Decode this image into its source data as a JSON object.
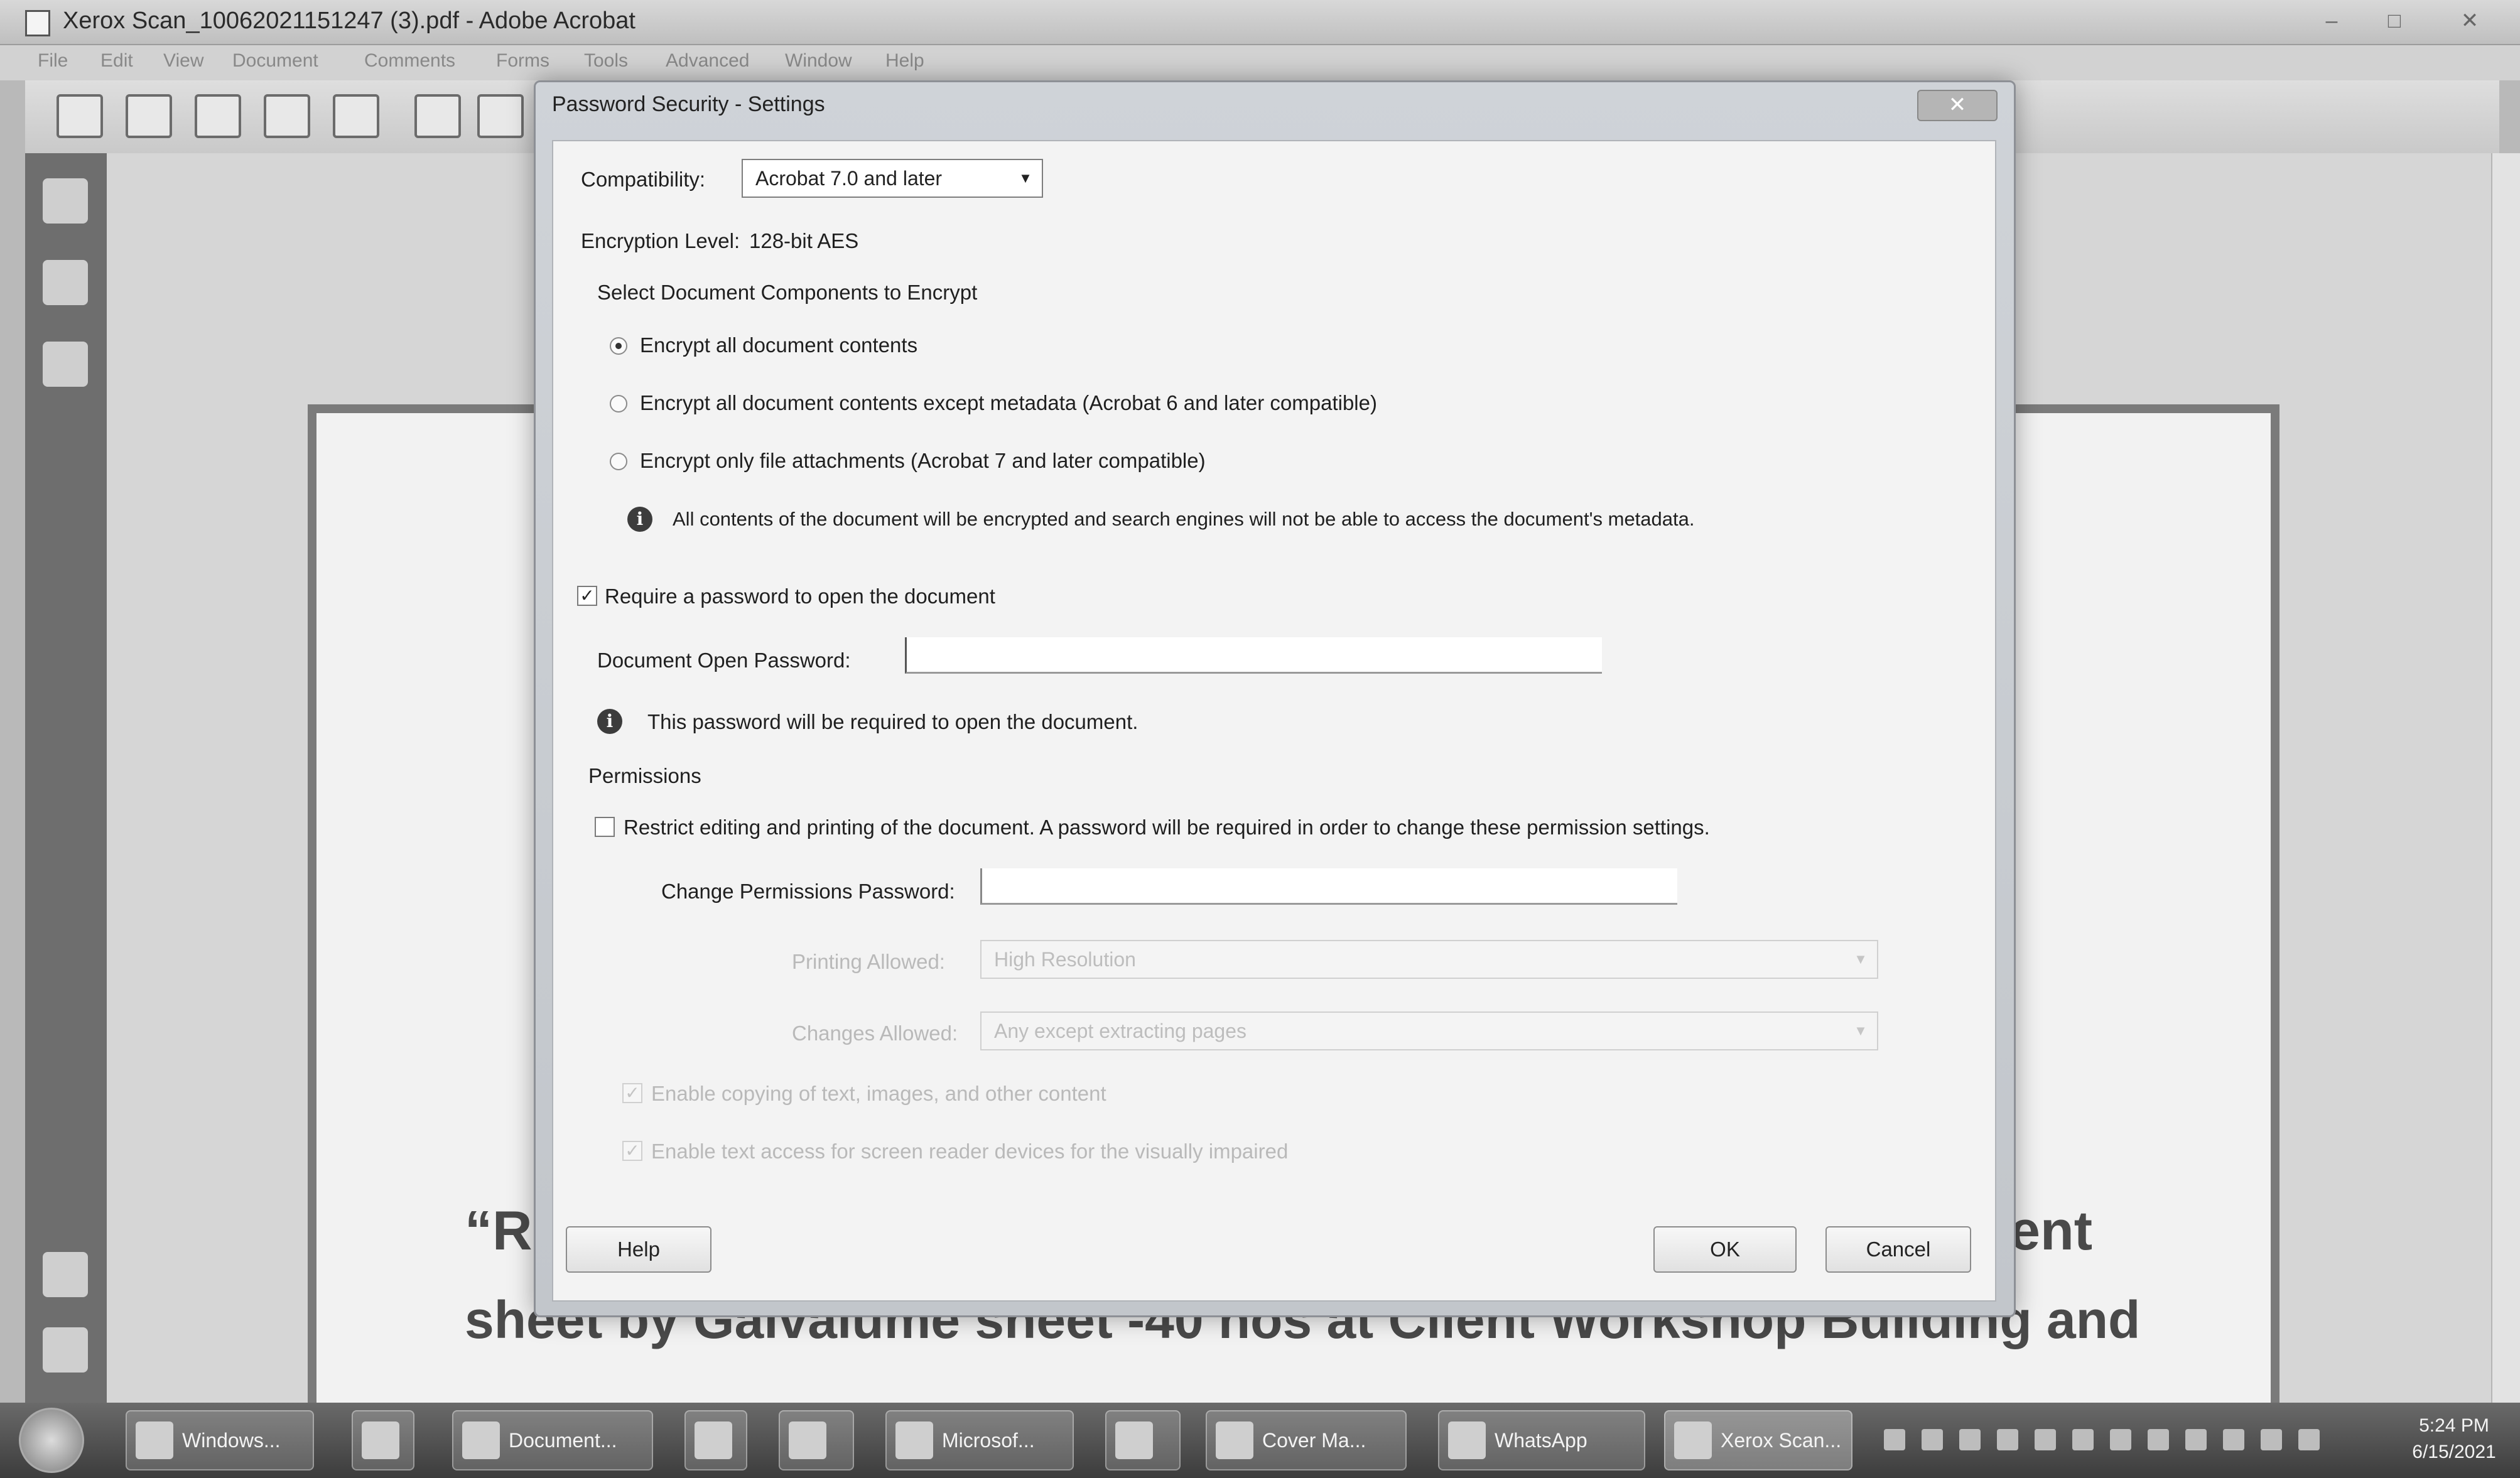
{
  "window": {
    "title": "Xerox Scan_10062021151247 (3).pdf - Adobe Acrobat",
    "controls": [
      "–",
      "□",
      "✕"
    ]
  },
  "menu": [
    "File",
    "Edit",
    "View",
    "Document",
    "Comments",
    "Forms",
    "Tools",
    "Advanced",
    "Window",
    "Help"
  ],
  "document": {
    "line1_start": "“R",
    "line1_end": "ent",
    "line2": "sheet by Galvalume sheet -40 nos at Client Workshop Building and"
  },
  "dialog": {
    "title": "Password Security - Settings",
    "compatibility_label": "Compatibility:",
    "compatibility_value": "Acrobat 7.0 and later",
    "encryption_level_label": "Encryption Level:",
    "encryption_level_value": "128-bit AES",
    "components_heading": "Select Document Components to Encrypt",
    "radio_all": "Encrypt all document contents",
    "radio_except_metadata": "Encrypt all document contents except metadata (Acrobat 6 and later compatible)",
    "radio_attachments": "Encrypt only file attachments (Acrobat 7 and later compatible)",
    "encrypt_info": "All contents of the document will be encrypted and search engines will not be able to access the document's metadata.",
    "require_open_password": "Require a password to open the document",
    "open_password_label": "Document Open Password:",
    "open_password_info": "This password will be required to open the document.",
    "permissions_heading": "Permissions",
    "restrict_editing": "Restrict editing and printing of the document. A password will be required in order to change these permission settings.",
    "change_permissions_label": "Change Permissions Password:",
    "printing_allowed_label": "Printing Allowed:",
    "printing_allowed_value": "High Resolution",
    "changes_allowed_label": "Changes Allowed:",
    "changes_allowed_value": "Any except extracting pages",
    "enable_copying": "Enable copying of text, images, and other content",
    "enable_screen_reader": "Enable text access for screen reader devices for the visually impaired",
    "help_button": "Help",
    "ok_button": "OK",
    "cancel_button": "Cancel"
  },
  "taskbar": {
    "tasks": [
      "Windows...",
      "Document...",
      "Microsof...",
      "Cover Ma...",
      "WhatsApp",
      "Xerox Scan..."
    ],
    "time": "5:24 PM",
    "date": "6/15/2021"
  },
  "colors": {
    "dialog_bg": "#f3f3f3",
    "taskbar": "#4a4a4a"
  }
}
